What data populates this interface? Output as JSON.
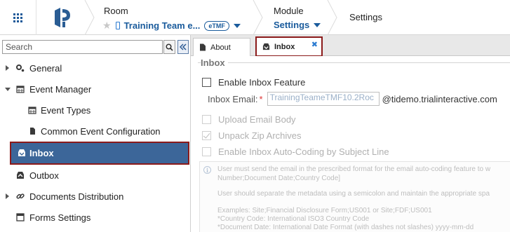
{
  "header": {
    "room_label": "Room",
    "room_value": "Training Team e...",
    "room_badge": "eTMF",
    "module_label": "Module",
    "module_value": "Settings",
    "page_title": "Settings"
  },
  "sidebar": {
    "search_placeholder": "Search",
    "items": [
      {
        "label": "General",
        "icon": "gears-icon",
        "expander": "collapsed"
      },
      {
        "label": "Event Manager",
        "icon": "calendar-icon",
        "expander": "expanded"
      },
      {
        "label": "Event Types",
        "icon": "calendar-icon"
      },
      {
        "label": "Common Event Configuration",
        "icon": "document-icon"
      },
      {
        "label": "Inbox",
        "icon": "inbox-icon",
        "selected": true
      },
      {
        "label": "Outbox",
        "icon": "outbox-icon"
      },
      {
        "label": "Documents Distribution",
        "icon": "link-icon",
        "expander": "collapsed"
      },
      {
        "label": "Forms Settings",
        "icon": "form-icon"
      }
    ]
  },
  "tabs": [
    {
      "label": "About",
      "icon": "document-icon"
    },
    {
      "label": "Inbox",
      "icon": "inbox-icon",
      "active": true
    }
  ],
  "inbox": {
    "section_title": "Inbox",
    "enable_label": "Enable Inbox Feature",
    "email_label": "Inbox Email:",
    "required_mark": "*",
    "email_value": "TrainingTeameTMF10.2Roc",
    "email_domain": "@tidemo.trialinteractive.com",
    "upload_body_label": "Upload Email Body",
    "unpack_zip_label": "Unpack Zip Archives",
    "auto_coding_label": "Enable Inbox Auto-Coding by Subject Line",
    "info_lines": [
      "User must send the email in the prescribed format for the email auto-coding feature to w",
      "Number;Document Date;Country Code]",
      "User should separate the metadata using a semicolon and maintain the appropriate spa",
      "Examples: Site;Financial Disclosure Form;US001 or Site;FDF;US001",
      "*Country Code: International ISO3 Country Code",
      "*Document Date: International Date Format (with dashes not slashes) yyyy-mm-dd"
    ]
  },
  "colors": {
    "brand_blue": "#1a5b9c",
    "selected_bg": "#3c6699",
    "highlight_outline": "#8b1a1a"
  }
}
